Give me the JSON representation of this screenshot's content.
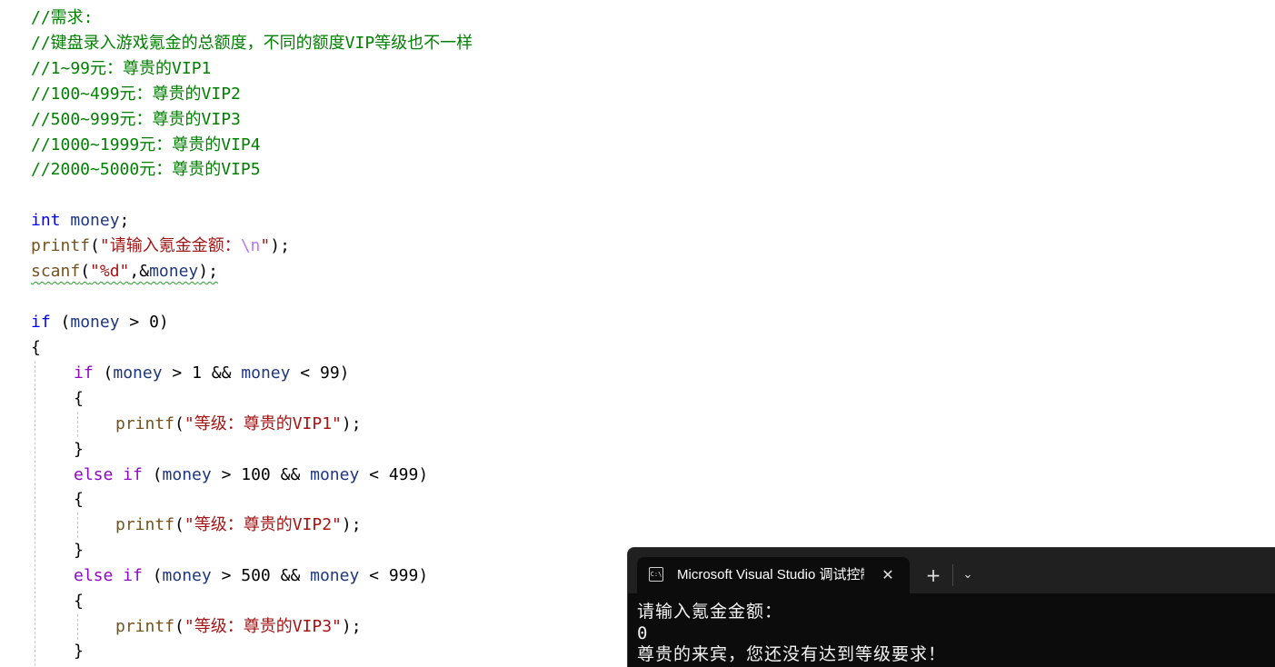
{
  "editor": {
    "comments": [
      "//需求:",
      "//键盘录入游戏氪金的总额度，不同的额度VIP等级也不一样",
      "//1~99元：尊贵的VIP1",
      "//100~499元：尊贵的VIP2",
      "//500~999元：尊贵的VIP3",
      "//1000~1999元：尊贵的VIP4",
      "//2000~5000元：尊贵的VIP5"
    ],
    "decl": {
      "type": "int",
      "var": "money",
      "semi": ";"
    },
    "printf_prompt": {
      "fn": "printf",
      "open": "(",
      "str_open": "\"请输入氪金金额：",
      "esc": "\\n",
      "str_close": "\"",
      "close": ");"
    },
    "scanf_line": {
      "fn": "scanf",
      "open": "(",
      "str": "\"%d\"",
      "comma": ",&",
      "var": "money",
      "close": ");"
    },
    "outer_if": {
      "kw": "if",
      "open": " (",
      "var": "money",
      "op": " > ",
      "num": "0",
      "close": ")"
    },
    "brace_open": "{",
    "brace_close": "}",
    "branch1": {
      "kw": "if",
      "open": " (",
      "var1": "money",
      "op1": " > ",
      "num1": "1",
      "and": " && ",
      "var2": "money",
      "op2": " < ",
      "num2": "99",
      "close": ")"
    },
    "print1": {
      "fn": "printf",
      "open": "(",
      "str": "\"等级：尊贵的VIP1\"",
      "close": ");"
    },
    "branch2": {
      "kw": "else if",
      "open": " (",
      "var1": "money",
      "op1": " > ",
      "num1": "100",
      "and": " && ",
      "var2": "money",
      "op2": " < ",
      "num2": "499",
      "close": ")"
    },
    "print2": {
      "fn": "printf",
      "open": "(",
      "str": "\"等级：尊贵的VIP2\"",
      "close": ");"
    },
    "branch3": {
      "kw": "else if",
      "open": " (",
      "var1": "money",
      "op1": " > ",
      "num1": "500",
      "and": " && ",
      "var2": "money",
      "op2": " < ",
      "num2": "999",
      "close": ")"
    },
    "print3": {
      "fn": "printf",
      "open": "(",
      "str": "\"等级：尊贵的VIP3\"",
      "close": ");"
    }
  },
  "colors": {
    "comment": "#008000",
    "keyword": "#0000ff",
    "control_keyword": "#8f08c4",
    "function": "#74531f",
    "variable": "#1f377f",
    "string": "#a31515",
    "escape": "#b776fb",
    "terminal_bg": "#0c0c0c",
    "terminal_text": "#f2f2f2"
  },
  "terminal": {
    "icon_text": "C:\\",
    "tab_title": "Microsoft Visual Studio 调试控制台",
    "close_glyph": "✕",
    "new_tab_glyph": "+",
    "dropdown_glyph": "⌄",
    "output": [
      "请输入氪金金额：",
      "0",
      "尊贵的来宾，您还没有达到等级要求！"
    ]
  }
}
